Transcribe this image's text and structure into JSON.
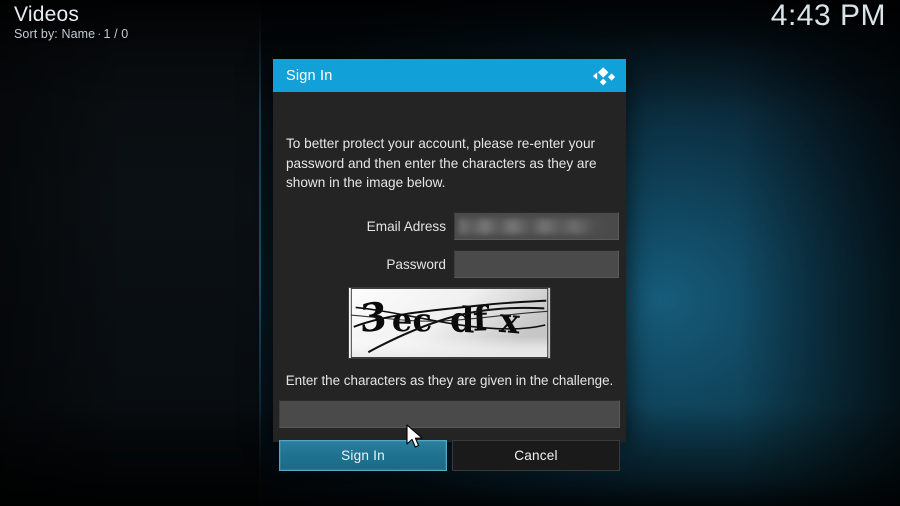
{
  "window": {
    "title": "Videos",
    "sort_label": "Sort by: Name",
    "separator": "·",
    "item_count": "1 / 0",
    "clock": "4:43 PM"
  },
  "dialog": {
    "header": {
      "title": "Sign In",
      "logo_icon": "kodi-logo-icon"
    },
    "message": "To better protect your account, please re-enter your password and then enter the characters as they are shown in the image below.",
    "fields": [
      {
        "label": "Email Adress",
        "value": "",
        "redacted": true,
        "placeholder": ""
      },
      {
        "label": "Password",
        "value": "",
        "redacted": false,
        "placeholder": ""
      }
    ],
    "captcha": {
      "icon": "captcha-image",
      "characters": "3ecdfx",
      "hint": "Enter the characters as they are given in the challenge.",
      "answer_value": "",
      "answer_placeholder": ""
    },
    "buttons": {
      "primary_label": "Sign In",
      "secondary_label": "Cancel"
    }
  },
  "pointer": {
    "icon": "mouse-arrow-cursor"
  },
  "colors": {
    "accent": "#11a0d8",
    "button_primary": "#1f7391",
    "dialog_bg": "#242424",
    "field_bg": "#4a4a4a",
    "background_teal": "#176080"
  }
}
